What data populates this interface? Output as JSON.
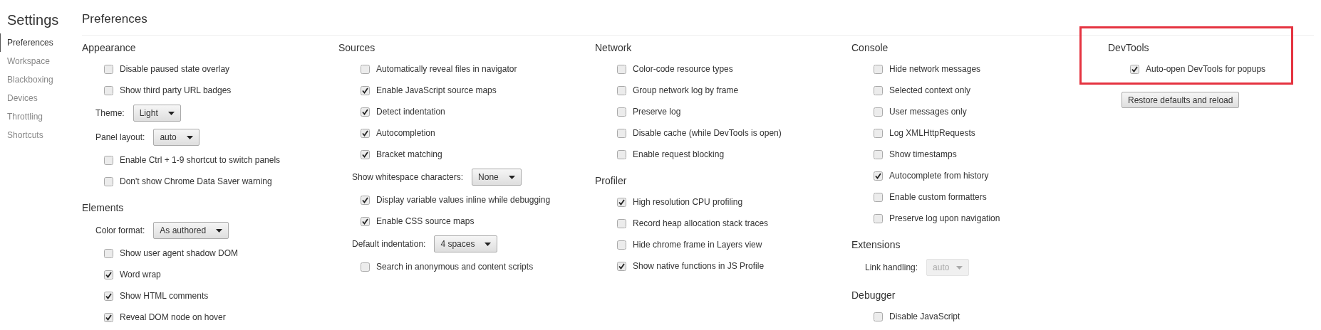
{
  "sidebar": {
    "title": "Settings",
    "items": [
      {
        "label": "Preferences",
        "selected": true
      },
      {
        "label": "Workspace",
        "selected": false
      },
      {
        "label": "Blackboxing",
        "selected": false
      },
      {
        "label": "Devices",
        "selected": false
      },
      {
        "label": "Throttling",
        "selected": false
      },
      {
        "label": "Shortcuts",
        "selected": false
      }
    ]
  },
  "page": {
    "title": "Preferences"
  },
  "columns": [
    {
      "sections": [
        {
          "title": "Appearance",
          "highlighted": false,
          "items": [
            {
              "kind": "checkbox",
              "label": "Disable paused state overlay",
              "checked": false
            },
            {
              "kind": "checkbox",
              "label": "Show third party URL badges",
              "checked": false
            },
            {
              "kind": "select",
              "label": "Theme:",
              "value": "Light",
              "disabled": false
            },
            {
              "kind": "select",
              "label": "Panel layout:",
              "value": "auto",
              "disabled": false
            },
            {
              "kind": "checkbox",
              "label": "Enable Ctrl + 1-9 shortcut to switch panels",
              "checked": false
            },
            {
              "kind": "checkbox",
              "label": "Don't show Chrome Data Saver warning",
              "checked": false
            }
          ]
        },
        {
          "title": "Elements",
          "highlighted": false,
          "items": [
            {
              "kind": "select",
              "label": "Color format:",
              "value": "As authored",
              "disabled": false
            },
            {
              "kind": "checkbox",
              "label": "Show user agent shadow DOM",
              "checked": false
            },
            {
              "kind": "checkbox",
              "label": "Word wrap",
              "checked": true
            },
            {
              "kind": "checkbox",
              "label": "Show HTML comments",
              "checked": true
            },
            {
              "kind": "checkbox",
              "label": "Reveal DOM node on hover",
              "checked": true
            }
          ]
        }
      ]
    },
    {
      "sections": [
        {
          "title": "Sources",
          "highlighted": false,
          "items": [
            {
              "kind": "checkbox",
              "label": "Automatically reveal files in navigator",
              "checked": false
            },
            {
              "kind": "checkbox",
              "label": "Enable JavaScript source maps",
              "checked": true
            },
            {
              "kind": "checkbox",
              "label": "Detect indentation",
              "checked": true
            },
            {
              "kind": "checkbox",
              "label": "Autocompletion",
              "checked": true
            },
            {
              "kind": "checkbox",
              "label": "Bracket matching",
              "checked": true
            },
            {
              "kind": "select",
              "label": "Show whitespace characters:",
              "value": "None",
              "disabled": false
            },
            {
              "kind": "checkbox",
              "label": "Display variable values inline while debugging",
              "checked": true
            },
            {
              "kind": "checkbox",
              "label": "Enable CSS source maps",
              "checked": true
            },
            {
              "kind": "select",
              "label": "Default indentation:",
              "value": "4 spaces",
              "disabled": false
            },
            {
              "kind": "checkbox",
              "label": "Search in anonymous and content scripts",
              "checked": false
            }
          ]
        }
      ]
    },
    {
      "sections": [
        {
          "title": "Network",
          "highlighted": false,
          "items": [
            {
              "kind": "checkbox",
              "label": "Color-code resource types",
              "checked": false
            },
            {
              "kind": "checkbox",
              "label": "Group network log by frame",
              "checked": false
            },
            {
              "kind": "checkbox",
              "label": "Preserve log",
              "checked": false
            },
            {
              "kind": "checkbox",
              "label": "Disable cache (while DevTools is open)",
              "checked": false
            },
            {
              "kind": "checkbox",
              "label": "Enable request blocking",
              "checked": false
            }
          ]
        },
        {
          "title": "Profiler",
          "highlighted": false,
          "items": [
            {
              "kind": "checkbox",
              "label": "High resolution CPU profiling",
              "checked": true
            },
            {
              "kind": "checkbox",
              "label": "Record heap allocation stack traces",
              "checked": false
            },
            {
              "kind": "checkbox",
              "label": "Hide chrome frame in Layers view",
              "checked": false
            },
            {
              "kind": "checkbox",
              "label": "Show native functions in JS Profile",
              "checked": true
            }
          ]
        }
      ]
    },
    {
      "sections": [
        {
          "title": "Console",
          "highlighted": false,
          "items": [
            {
              "kind": "checkbox",
              "label": "Hide network messages",
              "checked": false
            },
            {
              "kind": "checkbox",
              "label": "Selected context only",
              "checked": false
            },
            {
              "kind": "checkbox",
              "label": "User messages only",
              "checked": false
            },
            {
              "kind": "checkbox",
              "label": "Log XMLHttpRequests",
              "checked": false
            },
            {
              "kind": "checkbox",
              "label": "Show timestamps",
              "checked": false
            },
            {
              "kind": "checkbox",
              "label": "Autocomplete from history",
              "checked": true
            },
            {
              "kind": "checkbox",
              "label": "Enable custom formatters",
              "checked": false
            },
            {
              "kind": "checkbox",
              "label": "Preserve log upon navigation",
              "checked": false
            }
          ]
        },
        {
          "title": "Extensions",
          "highlighted": false,
          "items": [
            {
              "kind": "select",
              "label": "Link handling:",
              "value": "auto",
              "disabled": true
            }
          ]
        },
        {
          "title": "Debugger",
          "highlighted": false,
          "items": [
            {
              "kind": "checkbox",
              "label": "Disable JavaScript",
              "checked": false
            }
          ]
        }
      ]
    },
    {
      "sections": [
        {
          "title": "DevTools",
          "highlighted": true,
          "items": [
            {
              "kind": "checkbox",
              "label": "Auto-open DevTools for popups",
              "checked": true
            }
          ]
        }
      ],
      "button": "Restore defaults and reload"
    }
  ]
}
